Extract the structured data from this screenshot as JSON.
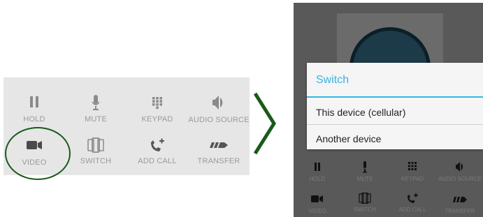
{
  "left_controls": [
    {
      "label": "HOLD"
    },
    {
      "label": "MUTE"
    },
    {
      "label": "KEYPAD"
    },
    {
      "label": "AUDIO SOURCE"
    },
    {
      "label": "VIDEO"
    },
    {
      "label": "SWITCH"
    },
    {
      "label": "ADD CALL"
    },
    {
      "label": "TRANSFER"
    }
  ],
  "dialog": {
    "title": "Switch",
    "options": [
      "This device (cellular)",
      "Another device"
    ]
  },
  "right_controls": [
    {
      "label": "HOLD"
    },
    {
      "label": "MUTE"
    },
    {
      "label": "KEYPAD"
    },
    {
      "label": "AUDIO SOURCE"
    },
    {
      "label": "VIDEO"
    },
    {
      "label": "SWITCH"
    },
    {
      "label": "ADD CALL"
    },
    {
      "label": "TRANSFER"
    }
  ],
  "colors": {
    "accent": "#33b5e5",
    "highlight": "#1a5a1a"
  }
}
